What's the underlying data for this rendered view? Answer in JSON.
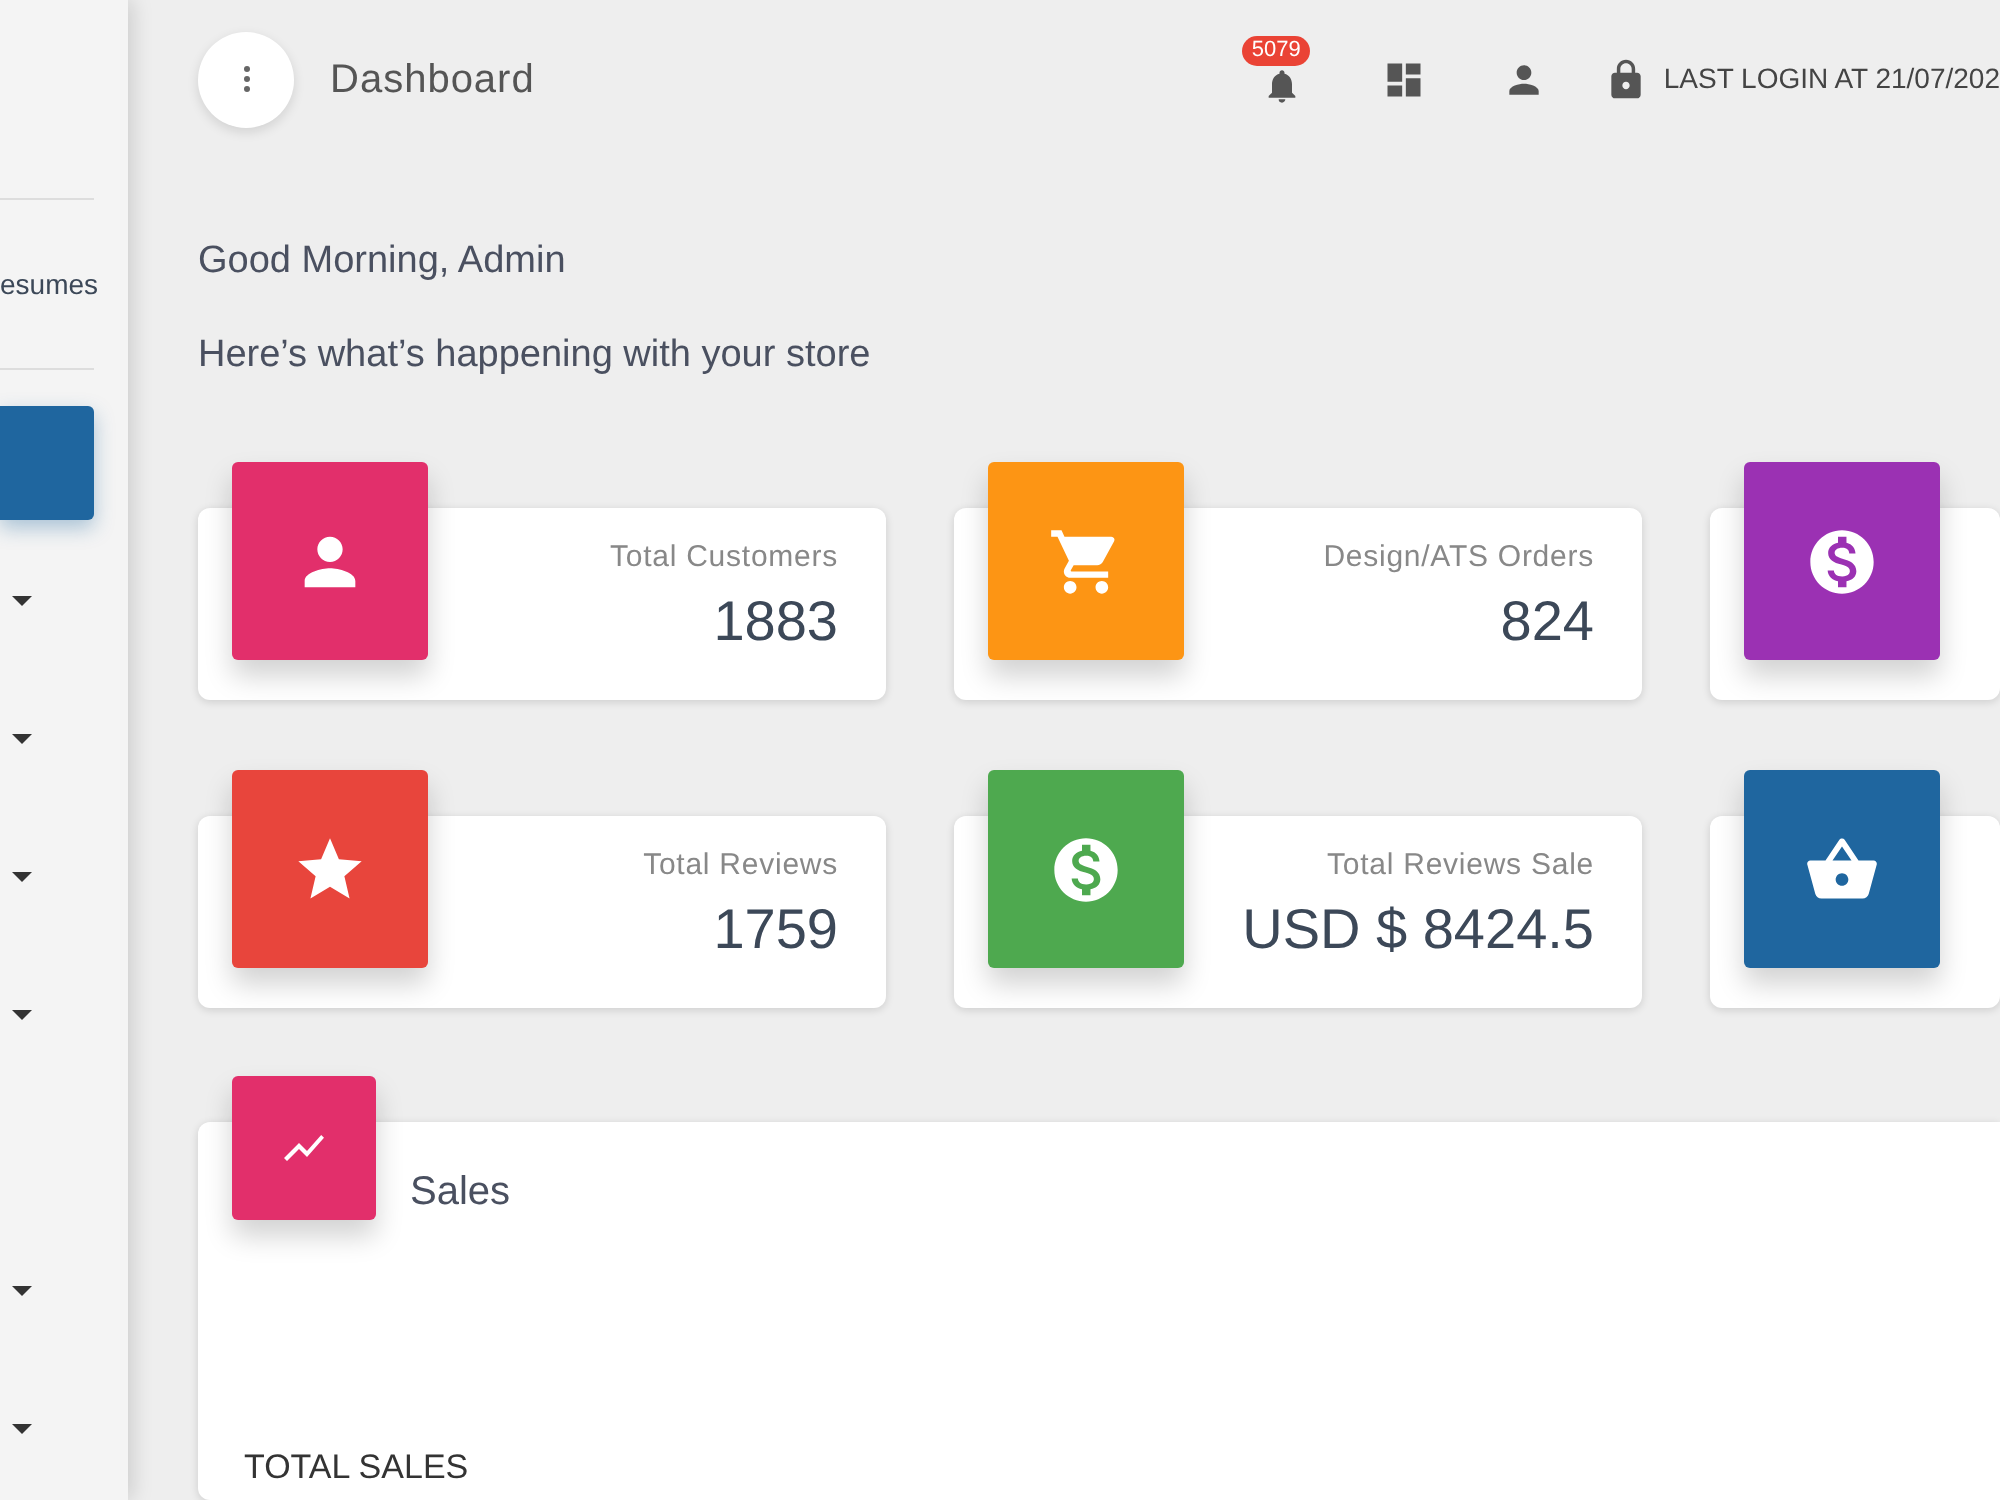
{
  "header": {
    "title": "Dashboard",
    "notifications_badge": "5079",
    "last_login": "LAST LOGIN AT 21/07/202"
  },
  "sidebar": {
    "section_label": "esumes",
    "items": [
      {
        "selected": true
      },
      {
        "selected": false
      },
      {
        "selected": false
      },
      {
        "selected": false
      },
      {
        "selected": false
      },
      {
        "selected": false
      },
      {
        "selected": false
      }
    ]
  },
  "greeting": "Good Morning, Admin",
  "subtitle": "Here’s what’s happening with your store",
  "stat_cards": [
    {
      "label": "Total Customers",
      "value": "1883",
      "color": "#e22f6b"
    },
    {
      "label": "Design/ATS Orders",
      "value": "824",
      "color": "#fd9514"
    },
    {
      "color": "#9b31b3"
    },
    {
      "label": "Total Reviews",
      "value": "1759",
      "color": "#e8453c"
    },
    {
      "label": "Total Reviews Sale",
      "value": "USD $ 8424.5",
      "color": "#4ea94f"
    },
    {
      "color": "#1f669f"
    }
  ],
  "sales": {
    "title": "Sales",
    "color": "#e22f6b",
    "total_label": "TOTAL SALES"
  }
}
